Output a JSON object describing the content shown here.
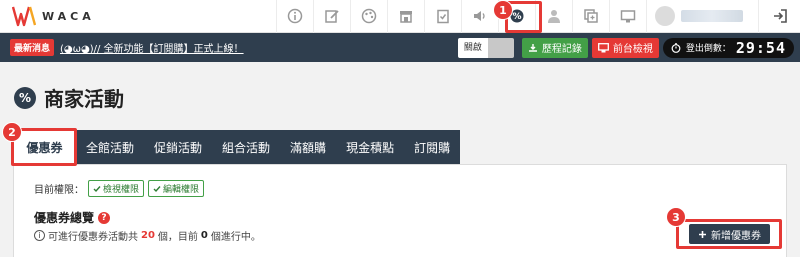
{
  "brand": {
    "name": "WACA"
  },
  "topbar": {
    "icons": [
      "info-icon",
      "edit-icon",
      "palette-icon",
      "store-icon",
      "clipboard-icon",
      "volume-icon",
      "promotion-settings-icon",
      "person-icon",
      "copy-icon",
      "monitor-icon"
    ],
    "logout_icon": "logout-icon"
  },
  "announcement": {
    "badge": "最新消息",
    "text": "(◕ω◕)// 全新功能【訂閱購】正式上線！"
  },
  "actions": {
    "close_label": "關啟",
    "history_label": "歷程記錄",
    "front_label": "前台檢視",
    "logout_countdown_label": "登出倒數：",
    "logout_countdown_value": "29:54"
  },
  "page": {
    "title": "商家活動",
    "title_icon": "%"
  },
  "tabs": [
    "優惠券",
    "全館活動",
    "促銷活動",
    "組合活動",
    "滿額購",
    "現金積點",
    "訂閱購"
  ],
  "panel": {
    "permission_label": "目前權限：",
    "perm_view": "檢視權限",
    "perm_edit": "編輯權限",
    "section_title": "優惠券總覽",
    "info_prefix": "可進行優惠券活動共",
    "total_count": "20",
    "info_middle": "個，目前",
    "active_count": "0",
    "info_suffix": "個進行中。",
    "add_button": "新增優惠券"
  },
  "annotations": {
    "step1": "1",
    "step2": "2",
    "step3": "3"
  },
  "colors": {
    "navy": "#2f3e4e",
    "accent_red": "#e53935",
    "green": "#43a047"
  }
}
